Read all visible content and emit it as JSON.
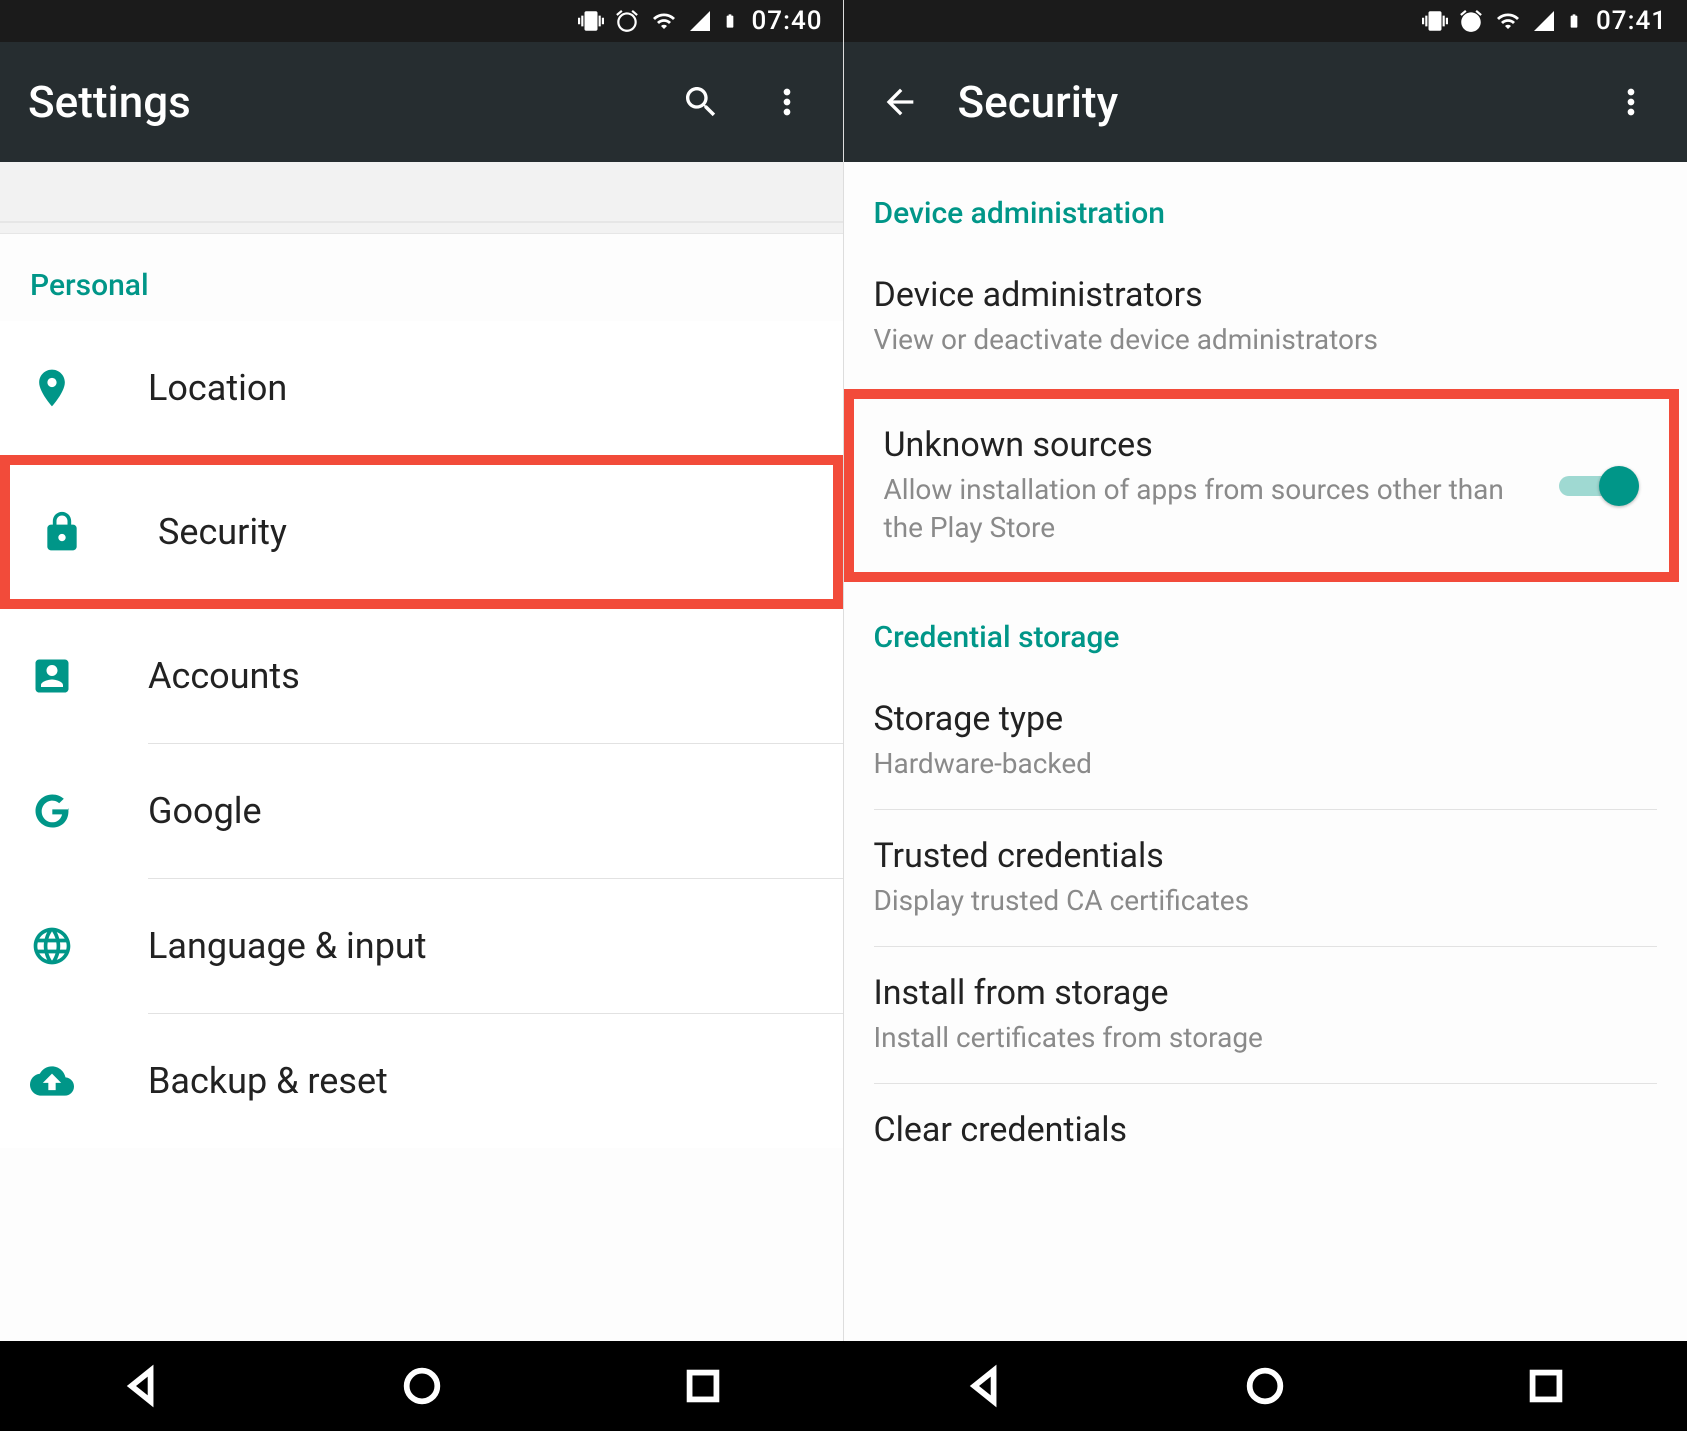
{
  "left": {
    "status": {
      "time": "07:40"
    },
    "appbar": {
      "title": "Settings"
    },
    "section_personal": "Personal",
    "items": {
      "location": "Location",
      "security": "Security",
      "accounts": "Accounts",
      "google": "Google",
      "language": "Language & input",
      "backup": "Backup & reset"
    }
  },
  "right": {
    "status": {
      "time": "07:41"
    },
    "appbar": {
      "title": "Security"
    },
    "section_device_admin": "Device administration",
    "device_admins": {
      "title": "Device administrators",
      "sub": "View or deactivate device administrators"
    },
    "unknown_sources": {
      "title": "Unknown sources",
      "sub": "Allow installation of apps from sources other than the Play Store",
      "enabled": true
    },
    "section_cred": "Credential storage",
    "storage_type": {
      "title": "Storage type",
      "sub": "Hardware-backed"
    },
    "trusted": {
      "title": "Trusted credentials",
      "sub": "Display trusted CA certificates"
    },
    "install_storage": {
      "title": "Install from storage",
      "sub": "Install certificates from storage"
    },
    "clear_cred": {
      "title": "Clear credentials"
    }
  }
}
